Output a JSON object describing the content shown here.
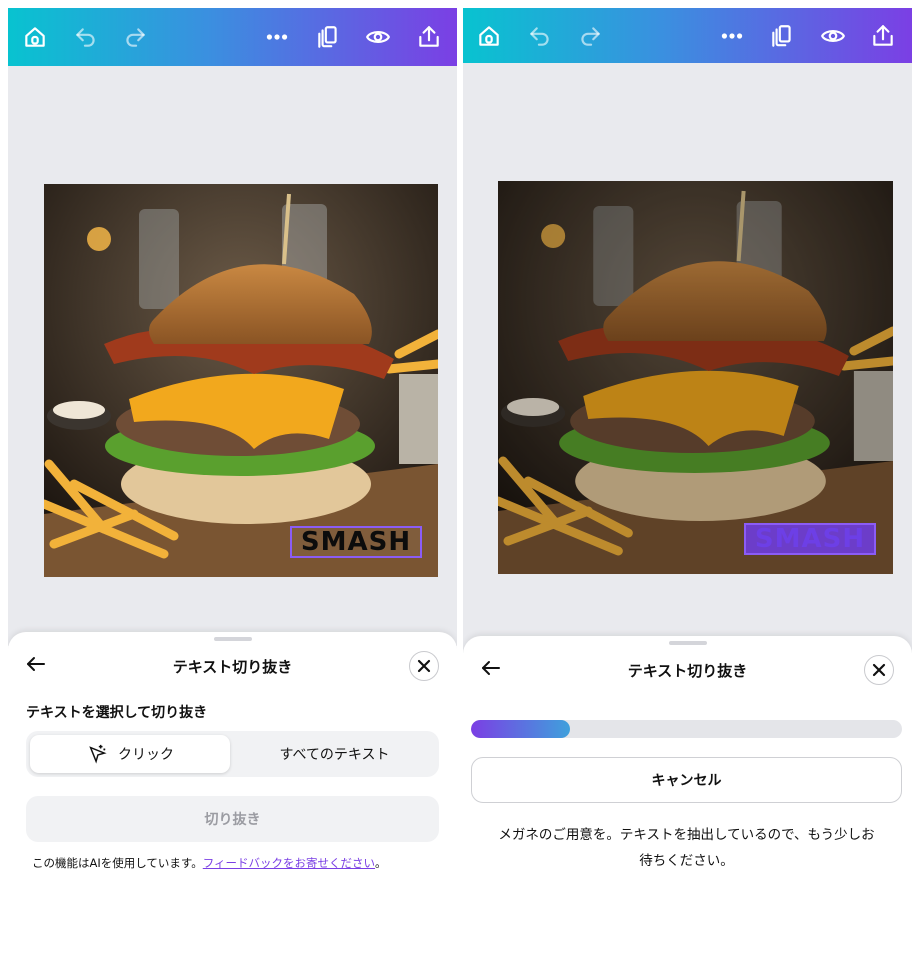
{
  "toolbar": {
    "icons": [
      "home-icon",
      "undo-icon",
      "redo-icon",
      "more-icon",
      "pages-icon",
      "preview-icon",
      "share-icon"
    ]
  },
  "image": {
    "overlay_text": "SMASH"
  },
  "left_sheet": {
    "title": "テキスト切り抜き",
    "section_label": "テキストを選択して切り抜き",
    "segment_click": "クリック",
    "segment_all": "すべてのテキスト",
    "cut_button": "切り抜き",
    "ai_note_prefix": "この機能はAIを使用しています。",
    "ai_note_link": "フィードバックをお寄せください",
    "ai_note_suffix": "。"
  },
  "right_sheet": {
    "title": "テキスト切り抜き",
    "progress": 0.23,
    "cancel_button": "キャンセル",
    "status_line1": "メガネのご用意を。テキストを抽出しているので、もう少しお",
    "status_line2": "待ちください。"
  },
  "colors": {
    "toolbar_gradient_start": "#08c3d0",
    "toolbar_gradient_end": "#7b3fe4",
    "accent": "#7a3fe4",
    "selection": "#8b5cf6"
  }
}
